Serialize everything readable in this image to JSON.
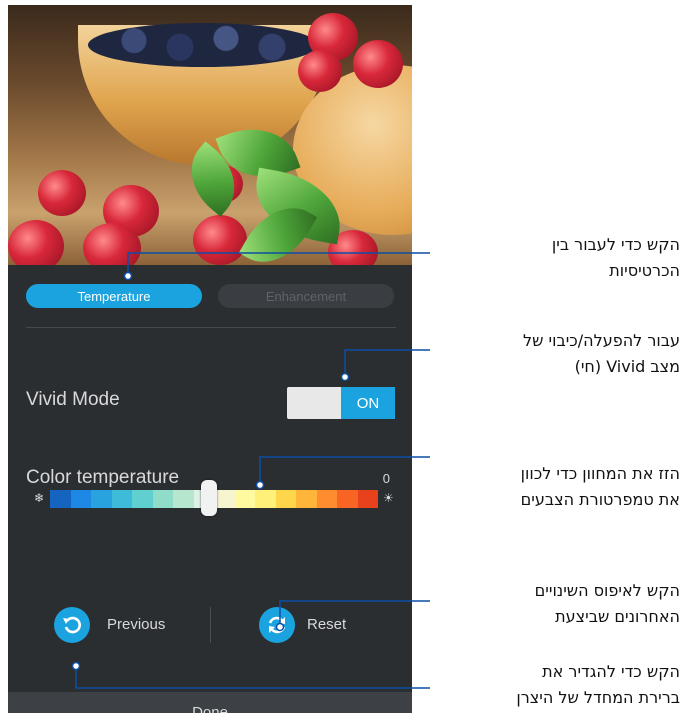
{
  "tabs": [
    {
      "label": "Temperature",
      "active": true
    },
    {
      "label": "Enhancement",
      "active": false
    }
  ],
  "vivid": {
    "label": "Vivid Mode",
    "toggle_state": "ON"
  },
  "color_temperature": {
    "label": "Color temperature",
    "value": "0",
    "slider_level_fraction": 0.5
  },
  "actions": {
    "previous": "Previous",
    "reset": "Reset",
    "done": "Done"
  },
  "callouts": [
    {
      "line1": "הקש כדי לעבור בין",
      "line2": "הכרטיסיות"
    },
    {
      "line1": "עבור להפעלה/כיבוי של",
      "line2": "מצב Vivid (חי)"
    },
    {
      "line1": "הזז את המחוון כדי לכוון",
      "line2": "את טמפרטורת הצבעים"
    },
    {
      "line1": "הקש לאיפוס השינויים",
      "line2": "האחרונים שביצעת"
    },
    {
      "line1": "הקש כדי להגדיר את",
      "line2": "ברירת המחדל של היצרן"
    }
  ],
  "colors": {
    "accent": "#1aa3de",
    "panel": "#2b2e31",
    "callout_line": "#0a4fa6"
  },
  "icons": [
    "snowflake-icon",
    "sun-icon",
    "undo-icon",
    "refresh-icon"
  ]
}
